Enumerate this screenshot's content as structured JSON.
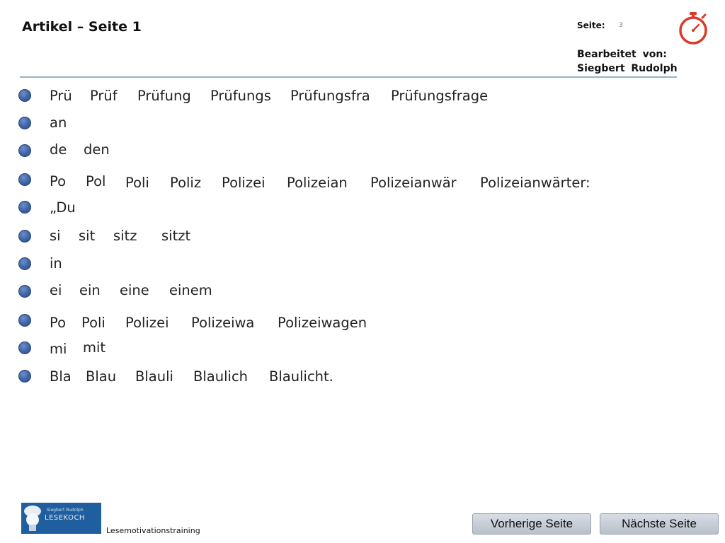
{
  "header": {
    "title": "Artikel – Seite 1",
    "seite_label": "Seite:",
    "seite_number": "3",
    "bearbeitet_label": "Bearbeitet von:",
    "author": "Siegbert Rudolph",
    "timer_icon": "stopwatch-icon",
    "timer_color": "#d93a2a"
  },
  "rows": [
    {
      "words": [
        "Prü",
        "Prüf",
        "Prüfung",
        "Prüfungs",
        "Prüfungsfra",
        "Prüfungsfrage"
      ]
    },
    {
      "words": [
        "an"
      ]
    },
    {
      "words": [
        "de",
        "den"
      ]
    },
    {
      "words": [
        "Po",
        "Pol",
        "Poli",
        "Poliz",
        "Polizei",
        "Polizeian",
        "Polizeianwär",
        "Polizeianwärter:"
      ]
    },
    {
      "words": [
        "„Du"
      ]
    },
    {
      "words": [
        "si",
        "sit",
        "sitz",
        "sitzt"
      ]
    },
    {
      "words": [
        "in"
      ]
    },
    {
      "words": [
        "ei",
        "ein",
        "eine",
        "einem"
      ]
    },
    {
      "words": [
        "Po",
        "Poli",
        "Polizei",
        "Polizeiwa",
        "Polizeiwagen"
      ]
    },
    {
      "words": [
        "mi",
        "mit"
      ]
    },
    {
      "words": [
        "Bla",
        "Blau",
        "Blauli",
        "Blaulich",
        "Blaulicht."
      ]
    }
  ],
  "footer": {
    "logo_line1": "Siegbert Rudolph",
    "logo_line2": "LESEKOCH",
    "label": "Lesemotivationstraining",
    "prev_button": "Vorherige Seite",
    "next_button": "Nächste Seite"
  },
  "colors": {
    "accent": "#3d63a8",
    "logo_bg": "#1f5fa0"
  }
}
